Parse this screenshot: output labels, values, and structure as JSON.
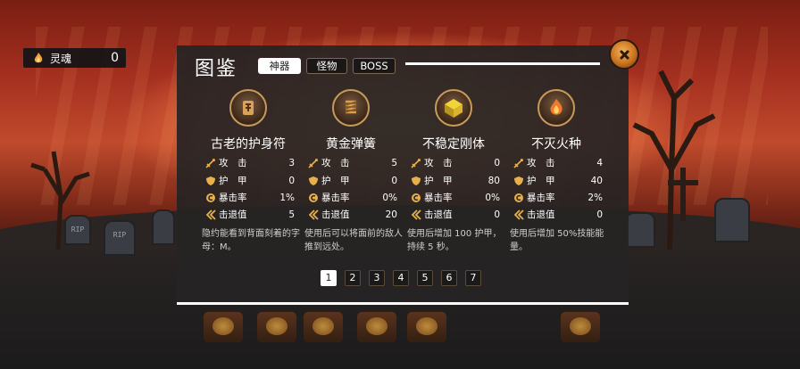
{
  "soul": {
    "label": "灵魂",
    "count": "0",
    "icon": "flame-icon"
  },
  "codex": {
    "title": "图鉴",
    "tabs": [
      {
        "label": "神器",
        "active": true
      },
      {
        "label": "怪物",
        "active": false
      },
      {
        "label": "BOSS",
        "active": false
      }
    ],
    "close_icon": "close-x-icon",
    "stat_labels": {
      "attack": "攻　击",
      "armor": "护　甲",
      "crit": "暴击率",
      "knockback": "击退值"
    },
    "cards": [
      {
        "name": "古老的护身符",
        "icon": "amulet-icon",
        "attack": "3",
        "armor": "0",
        "crit": "1%",
        "knockback": "5",
        "desc": "隐约能看到背面刻着的字母：M。"
      },
      {
        "name": "黄金弹簧",
        "icon": "spring-icon",
        "attack": "5",
        "armor": "0",
        "crit": "0%",
        "knockback": "20",
        "desc": "使用后可以将面前的敌人推到远处。"
      },
      {
        "name": "不稳定刚体",
        "icon": "crystal-cube-icon",
        "attack": "0",
        "armor": "80",
        "crit": "0%",
        "knockback": "0",
        "desc": "使用后增加 100 护甲，持续 5 秒。"
      },
      {
        "name": "不灭火种",
        "icon": "eternal-fire-icon",
        "attack": "4",
        "armor": "40",
        "crit": "2%",
        "knockback": "0",
        "desc": "使用后增加 50%技能能量。"
      }
    ],
    "pages": [
      "1",
      "2",
      "3",
      "4",
      "5",
      "6",
      "7"
    ],
    "current_page": "1"
  },
  "colors": {
    "accent_gold": "#c79a5b",
    "panel_bg": "#262423",
    "active_tab_bg": "#ffffff"
  }
}
